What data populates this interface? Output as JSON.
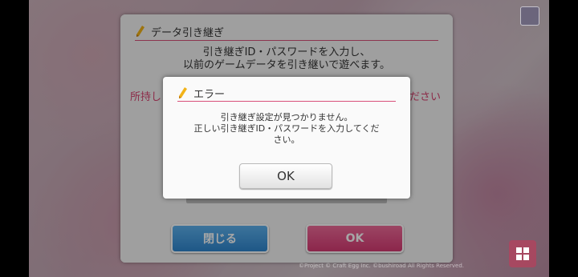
{
  "transfer_dialog": {
    "title": "データ引き継ぎ",
    "instruction_line1": "引き継ぎID・パスワードを入力し、",
    "instruction_line2": "以前のゲームデータを引き継いで遊べます。",
    "side_text_left": "所持し",
    "side_text_right": "ださい",
    "close_button": "閉じる",
    "ok_button": "OK"
  },
  "error_dialog": {
    "title": "エラー",
    "message_line1": "引き継ぎ設定が見つかりません。",
    "message_line2": "正しい引き継ぎID・パスワードを入力してくだ",
    "message_line3": "さい。",
    "ok_button": "OK"
  },
  "footer": {
    "copyright": "©Project © Craft Egg Inc. ©bushiroad All Rights Reserved."
  },
  "icons": {
    "pen": "pen-icon",
    "menu": "grid-menu-icon"
  },
  "colors": {
    "accent_pink": "#d8426f",
    "button_blue": "#2f86cf",
    "button_pink": "#d63a73"
  }
}
